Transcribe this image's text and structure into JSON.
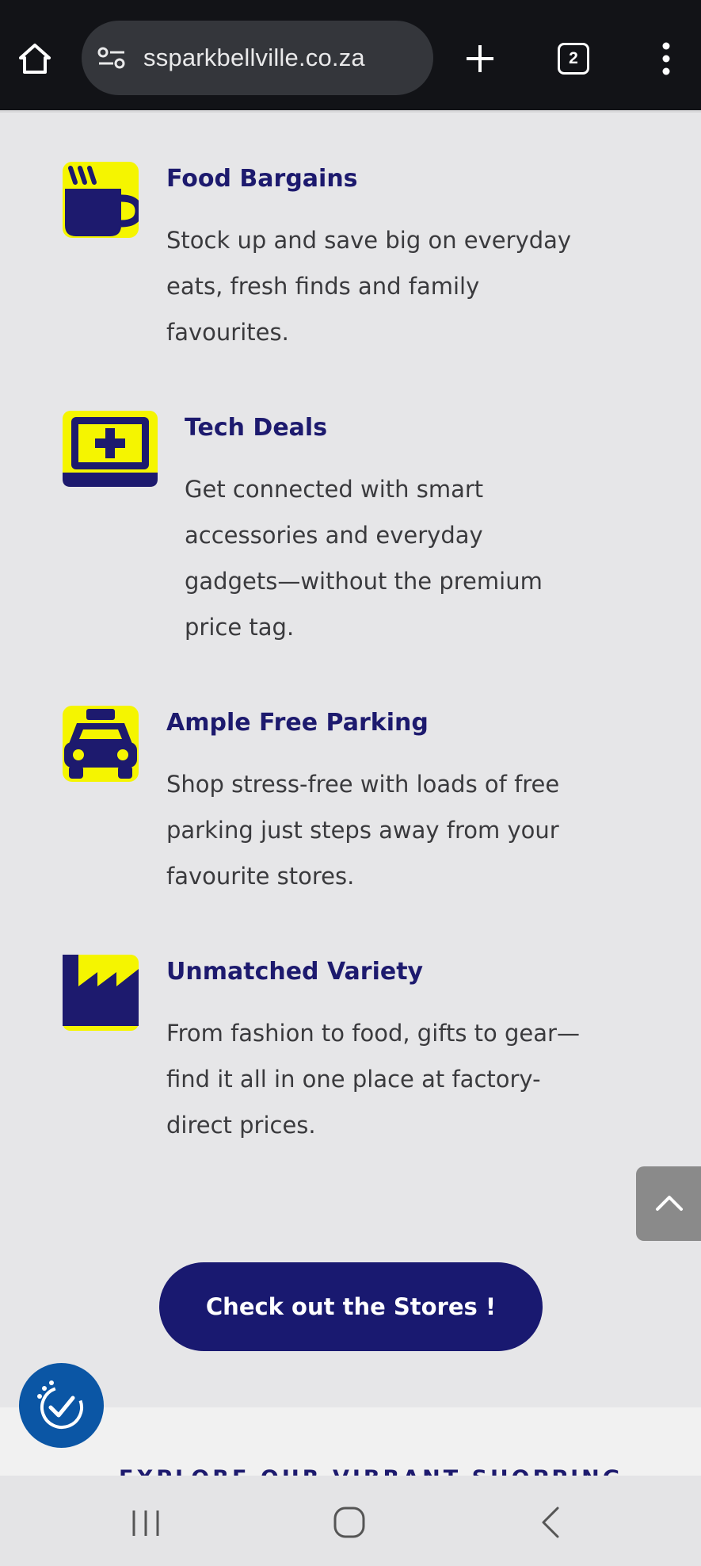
{
  "browser": {
    "url": "ssparkbellville.co.za",
    "tab_count": "2",
    "icons": {
      "home": "home-icon",
      "site_settings": "tune-icon",
      "new_tab": "plus-icon",
      "menu": "kebab-menu-icon"
    }
  },
  "features": [
    {
      "title": "Food Bargains",
      "lines": [
        "Stock up and save big on everyday",
        "eats, fresh finds and family",
        "favourites."
      ],
      "icon": "coffee-cup-icon"
    },
    {
      "title": "Tech Deals",
      "lines": [
        "Get connected with smart",
        "accessories and everyday",
        "gadgets—without the premium",
        "price tag."
      ],
      "icon": "laptop-medical-icon"
    },
    {
      "title": "Ample Free Parking",
      "lines": [
        "Shop stress-free with loads of free",
        "parking just steps away from your",
        "favourite stores."
      ],
      "icon": "taxi-icon"
    },
    {
      "title": "Unmatched Variety",
      "lines": [
        "From fashion to food, gifts to gear—",
        "find it all in one place at factory-",
        "direct prices."
      ],
      "icon": "industry-icon"
    }
  ],
  "cta": {
    "label": "Check out the Stores !"
  },
  "section_peek": "EXPLORE OUR VIBRANT SHOPPING",
  "colors": {
    "accent_yellow": "#f5f500",
    "brand_navy": "#191970",
    "page_bg": "#e6e6e8",
    "a11y_blue": "#0b56a5"
  }
}
